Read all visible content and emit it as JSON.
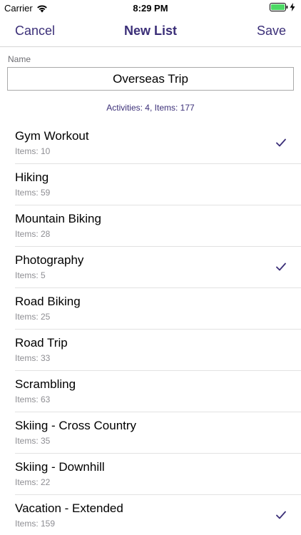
{
  "status_bar": {
    "carrier": "Carrier",
    "time": "8:29 PM",
    "icons": [
      "wifi-icon",
      "battery-icon",
      "charging-bolt-icon"
    ],
    "battery_color": "#4cd964"
  },
  "nav": {
    "cancel_label": "Cancel",
    "title": "New List",
    "save_label": "Save",
    "accent_color": "#3b2f78"
  },
  "form": {
    "name_label": "Name",
    "name_value": "Overseas Trip",
    "summary": "Activities: 4, Items: 177"
  },
  "activities": [
    {
      "title": "Gym Workout",
      "count": "Items: 10",
      "checked": true
    },
    {
      "title": "Hiking",
      "count": "Items: 59",
      "checked": false
    },
    {
      "title": "Mountain Biking",
      "count": "Items: 28",
      "checked": false
    },
    {
      "title": "Photography",
      "count": "Items: 5",
      "checked": true
    },
    {
      "title": "Road Biking",
      "count": "Items: 25",
      "checked": false
    },
    {
      "title": "Road Trip",
      "count": "Items: 33",
      "checked": false
    },
    {
      "title": "Scrambling",
      "count": "Items: 63",
      "checked": false
    },
    {
      "title": "Skiing - Cross Country",
      "count": "Items: 35",
      "checked": false
    },
    {
      "title": "Skiing - Downhill",
      "count": "Items: 22",
      "checked": false
    },
    {
      "title": "Vacation - Extended",
      "count": "Items: 159",
      "checked": true
    }
  ]
}
